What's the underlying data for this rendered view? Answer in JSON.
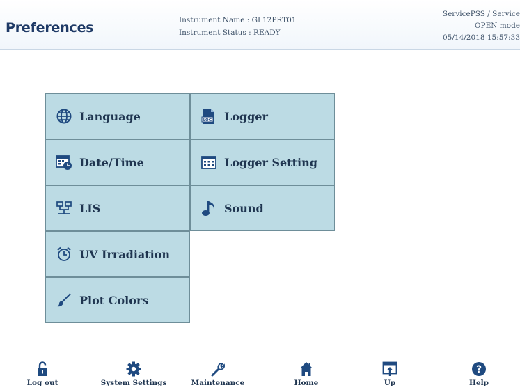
{
  "header": {
    "title": "Preferences",
    "instrument_name": "Instrument Name : GL12PRT01",
    "instrument_status": "Instrument Status : READY",
    "user": "ServicePSS / Service",
    "mode": "OPEN mode",
    "datetime": "05/14/2018 15:57:33"
  },
  "tiles": {
    "language": "Language",
    "logger": "Logger",
    "date_time": "Date/Time",
    "logger_setting": "Logger Setting",
    "lis": "LIS",
    "sound": "Sound",
    "uv_irradiation": "UV Irradiation",
    "plot_colors": "Plot Colors"
  },
  "footer": {
    "log_out": "Log out",
    "system_settings": "System Settings",
    "maintenance": "Maintenance",
    "home": "Home",
    "up": "Up",
    "help": "Help"
  },
  "colors": {
    "tile_bg": "#bcdbe4",
    "tile_border": "#6e8e99",
    "text_dark": "#1f3550",
    "icon_blue": "#1f4a80"
  }
}
